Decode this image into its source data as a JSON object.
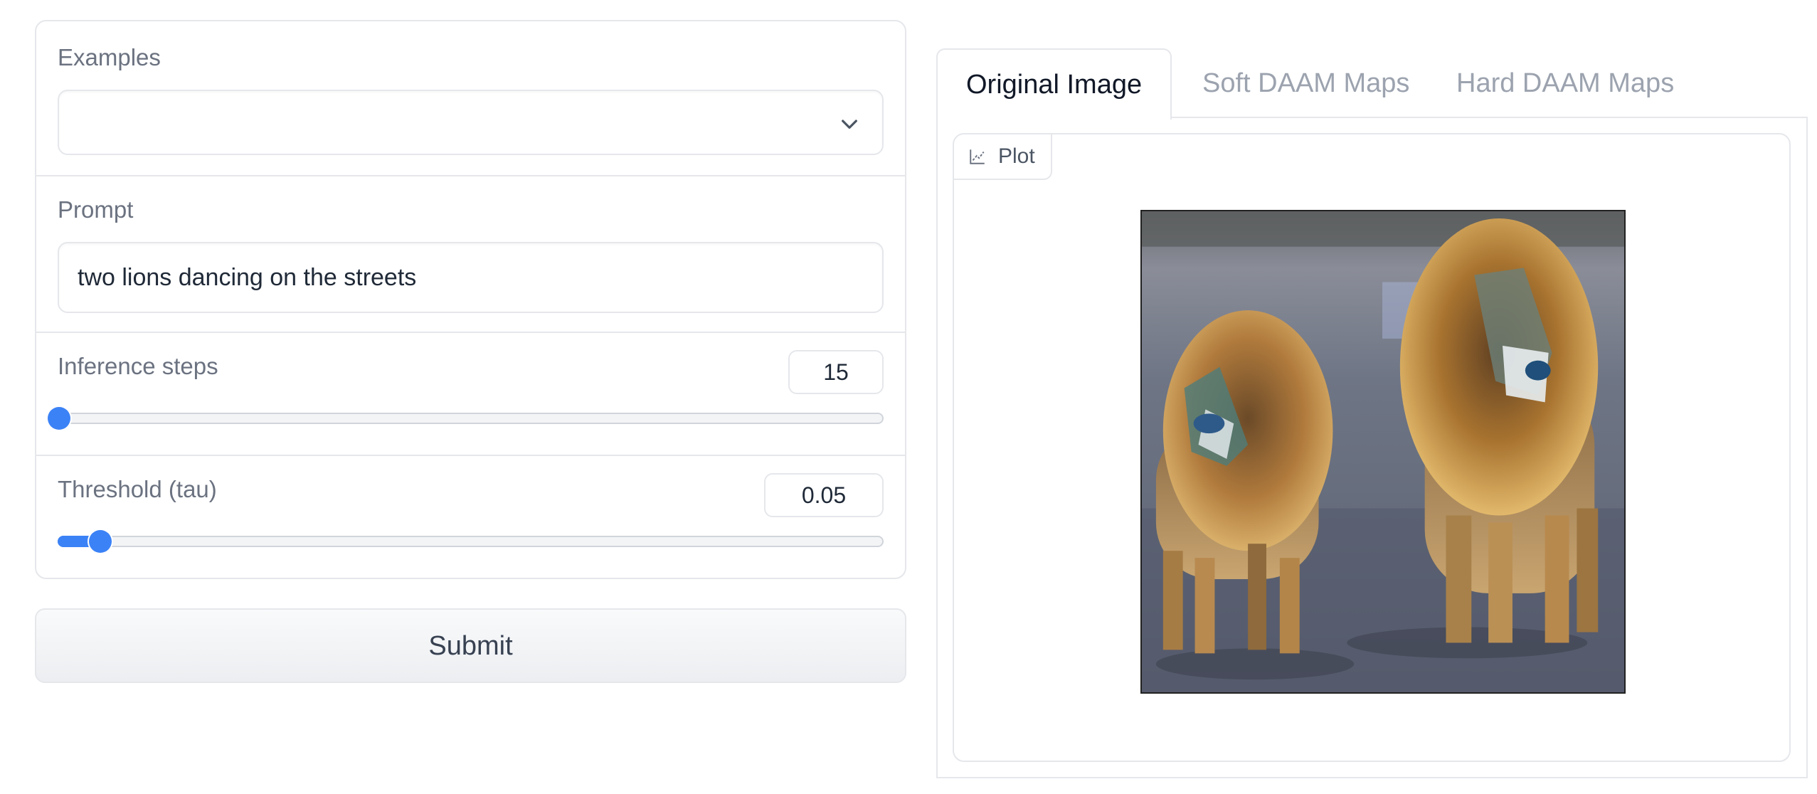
{
  "examples": {
    "label": "Examples",
    "value": ""
  },
  "prompt": {
    "label": "Prompt",
    "value": "two lions dancing on the streets"
  },
  "inference_steps": {
    "label": "Inference steps",
    "value": "15",
    "fraction": 0.0
  },
  "threshold": {
    "label": "Threshold (tau)",
    "value": "0.05",
    "fraction": 0.05
  },
  "submit_label": "Submit",
  "tabs": [
    {
      "label": "Original Image",
      "active": true
    },
    {
      "label": "Soft DAAM Maps",
      "active": false
    },
    {
      "label": "Hard DAAM Maps",
      "active": false
    }
  ],
  "plot": {
    "label": "Plot"
  },
  "colors": {
    "accent": "#3b82f6",
    "border": "#e5e7eb"
  }
}
